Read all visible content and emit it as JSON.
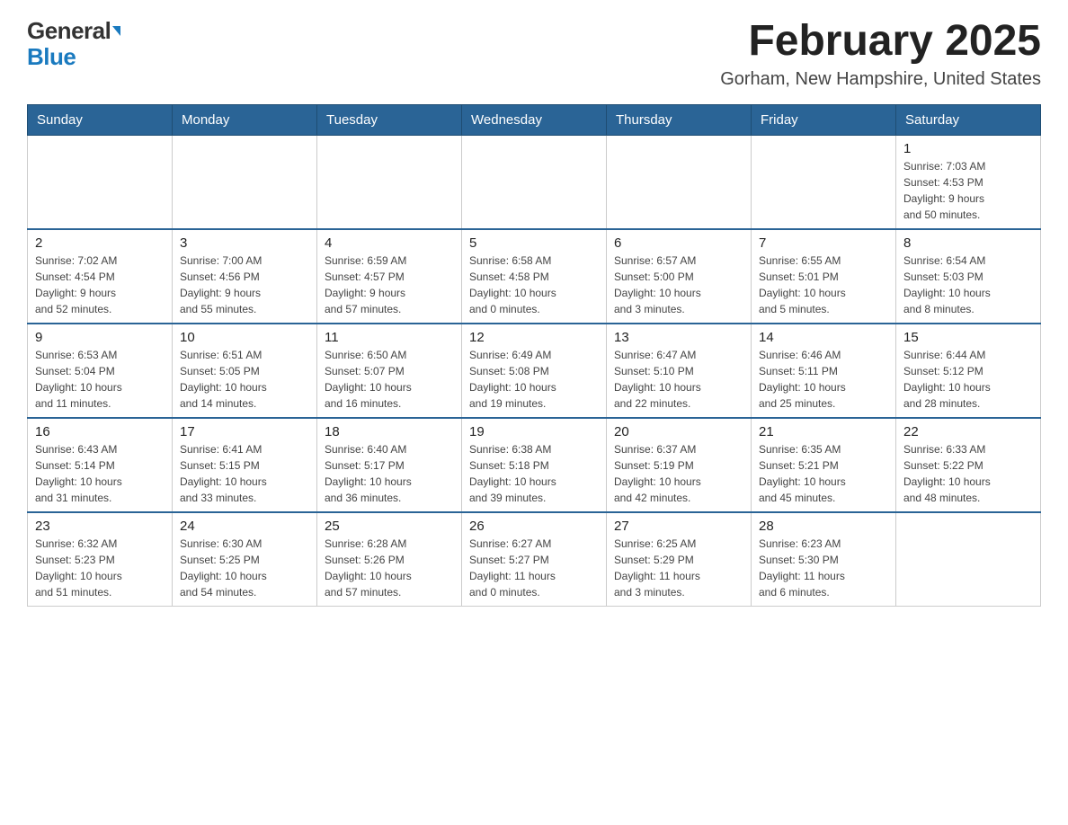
{
  "header": {
    "logo": {
      "general": "General",
      "blue": "Blue"
    },
    "title": "February 2025",
    "location": "Gorham, New Hampshire, United States"
  },
  "calendar": {
    "days_of_week": [
      "Sunday",
      "Monday",
      "Tuesday",
      "Wednesday",
      "Thursday",
      "Friday",
      "Saturday"
    ],
    "weeks": [
      [
        {
          "day": "",
          "info": ""
        },
        {
          "day": "",
          "info": ""
        },
        {
          "day": "",
          "info": ""
        },
        {
          "day": "",
          "info": ""
        },
        {
          "day": "",
          "info": ""
        },
        {
          "day": "",
          "info": ""
        },
        {
          "day": "1",
          "info": "Sunrise: 7:03 AM\nSunset: 4:53 PM\nDaylight: 9 hours\nand 50 minutes."
        }
      ],
      [
        {
          "day": "2",
          "info": "Sunrise: 7:02 AM\nSunset: 4:54 PM\nDaylight: 9 hours\nand 52 minutes."
        },
        {
          "day": "3",
          "info": "Sunrise: 7:00 AM\nSunset: 4:56 PM\nDaylight: 9 hours\nand 55 minutes."
        },
        {
          "day": "4",
          "info": "Sunrise: 6:59 AM\nSunset: 4:57 PM\nDaylight: 9 hours\nand 57 minutes."
        },
        {
          "day": "5",
          "info": "Sunrise: 6:58 AM\nSunset: 4:58 PM\nDaylight: 10 hours\nand 0 minutes."
        },
        {
          "day": "6",
          "info": "Sunrise: 6:57 AM\nSunset: 5:00 PM\nDaylight: 10 hours\nand 3 minutes."
        },
        {
          "day": "7",
          "info": "Sunrise: 6:55 AM\nSunset: 5:01 PM\nDaylight: 10 hours\nand 5 minutes."
        },
        {
          "day": "8",
          "info": "Sunrise: 6:54 AM\nSunset: 5:03 PM\nDaylight: 10 hours\nand 8 minutes."
        }
      ],
      [
        {
          "day": "9",
          "info": "Sunrise: 6:53 AM\nSunset: 5:04 PM\nDaylight: 10 hours\nand 11 minutes."
        },
        {
          "day": "10",
          "info": "Sunrise: 6:51 AM\nSunset: 5:05 PM\nDaylight: 10 hours\nand 14 minutes."
        },
        {
          "day": "11",
          "info": "Sunrise: 6:50 AM\nSunset: 5:07 PM\nDaylight: 10 hours\nand 16 minutes."
        },
        {
          "day": "12",
          "info": "Sunrise: 6:49 AM\nSunset: 5:08 PM\nDaylight: 10 hours\nand 19 minutes."
        },
        {
          "day": "13",
          "info": "Sunrise: 6:47 AM\nSunset: 5:10 PM\nDaylight: 10 hours\nand 22 minutes."
        },
        {
          "day": "14",
          "info": "Sunrise: 6:46 AM\nSunset: 5:11 PM\nDaylight: 10 hours\nand 25 minutes."
        },
        {
          "day": "15",
          "info": "Sunrise: 6:44 AM\nSunset: 5:12 PM\nDaylight: 10 hours\nand 28 minutes."
        }
      ],
      [
        {
          "day": "16",
          "info": "Sunrise: 6:43 AM\nSunset: 5:14 PM\nDaylight: 10 hours\nand 31 minutes."
        },
        {
          "day": "17",
          "info": "Sunrise: 6:41 AM\nSunset: 5:15 PM\nDaylight: 10 hours\nand 33 minutes."
        },
        {
          "day": "18",
          "info": "Sunrise: 6:40 AM\nSunset: 5:17 PM\nDaylight: 10 hours\nand 36 minutes."
        },
        {
          "day": "19",
          "info": "Sunrise: 6:38 AM\nSunset: 5:18 PM\nDaylight: 10 hours\nand 39 minutes."
        },
        {
          "day": "20",
          "info": "Sunrise: 6:37 AM\nSunset: 5:19 PM\nDaylight: 10 hours\nand 42 minutes."
        },
        {
          "day": "21",
          "info": "Sunrise: 6:35 AM\nSunset: 5:21 PM\nDaylight: 10 hours\nand 45 minutes."
        },
        {
          "day": "22",
          "info": "Sunrise: 6:33 AM\nSunset: 5:22 PM\nDaylight: 10 hours\nand 48 minutes."
        }
      ],
      [
        {
          "day": "23",
          "info": "Sunrise: 6:32 AM\nSunset: 5:23 PM\nDaylight: 10 hours\nand 51 minutes."
        },
        {
          "day": "24",
          "info": "Sunrise: 6:30 AM\nSunset: 5:25 PM\nDaylight: 10 hours\nand 54 minutes."
        },
        {
          "day": "25",
          "info": "Sunrise: 6:28 AM\nSunset: 5:26 PM\nDaylight: 10 hours\nand 57 minutes."
        },
        {
          "day": "26",
          "info": "Sunrise: 6:27 AM\nSunset: 5:27 PM\nDaylight: 11 hours\nand 0 minutes."
        },
        {
          "day": "27",
          "info": "Sunrise: 6:25 AM\nSunset: 5:29 PM\nDaylight: 11 hours\nand 3 minutes."
        },
        {
          "day": "28",
          "info": "Sunrise: 6:23 AM\nSunset: 5:30 PM\nDaylight: 11 hours\nand 6 minutes."
        },
        {
          "day": "",
          "info": ""
        }
      ]
    ]
  }
}
